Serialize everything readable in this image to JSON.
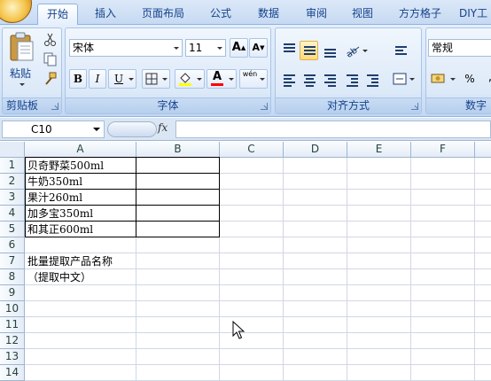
{
  "tabs": [
    "开始",
    "插入",
    "页面布局",
    "公式",
    "数据",
    "审阅",
    "视图",
    "方方格子",
    "DIY工"
  ],
  "active_tab": "开始",
  "clipboard": {
    "paste_label": "粘贴",
    "group_label": "剪贴板"
  },
  "font": {
    "name": "宋体",
    "size": "11",
    "grow": "A",
    "shrink": "A",
    "bold": "B",
    "italic": "I",
    "underline": "U",
    "font_color_letter": "A",
    "phonetic": "wén",
    "group_label": "字体"
  },
  "alignment": {
    "group_label": "对齐方式"
  },
  "number": {
    "format": "常规",
    "percent": "%",
    "group_label": "数字"
  },
  "formula_bar": {
    "name_box": "C10",
    "fx": "fx",
    "content": ""
  },
  "columns": [
    "A",
    "B",
    "C",
    "D",
    "E",
    "F"
  ],
  "rows": [
    "1",
    "2",
    "3",
    "4",
    "5",
    "6",
    "7",
    "8",
    "9",
    "10",
    "11",
    "12",
    "13",
    "14"
  ],
  "cells": {
    "A1": "贝奇野菜500ml",
    "A2": "牛奶350ml",
    "A3": "果汁260ml",
    "A4": "加多宝350ml",
    "A5": "和其正600ml",
    "A7": "批量提取产品名称",
    "A8": "（提取中文）"
  },
  "colors": {
    "ribbon_text": "#15428b",
    "grid_line": "#d0d7e5",
    "header_border": "#9eb6ce",
    "highlight": "#ffd87a"
  }
}
